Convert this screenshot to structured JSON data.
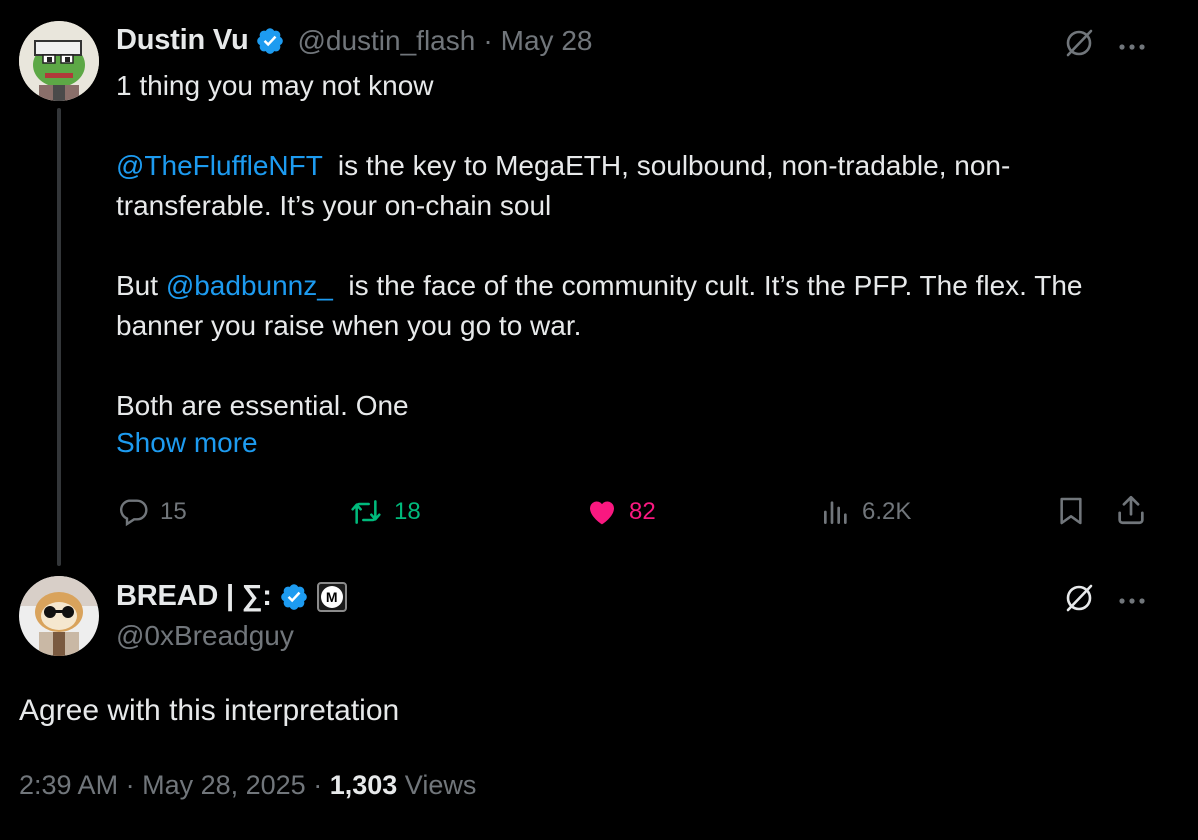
{
  "tweet": {
    "author_name": "Dustin Vu",
    "handle": "@dustin_flash",
    "date": "May 28",
    "line1": "1 thing you may not know",
    "para2_mention": "@TheFluffleNFT",
    "para2_rest": "  is the key to MegaETH, soulbound, non-tradable, non-transferable. It’s your on-chain soul",
    "para3_start": "But ",
    "para3_mention": "@badbunnz_",
    "para3_rest": "  is the face of the community cult. It’s the PFP. The flex. The banner you raise when you go to war.",
    "para4": "Both are essential. One",
    "show_more": "Show more",
    "replies": "15",
    "reposts": "18",
    "likes": "82",
    "views": "6.2K",
    "colors": {
      "repost": "#00ba7c",
      "like": "#f91880",
      "link": "#1d9bf0",
      "verified": "#1d9bf0"
    }
  },
  "reply": {
    "author_name": "BREAD | ∑:",
    "handle": "@0xBreadguy",
    "text": "Agree with this interpretation",
    "time": "2:39 AM",
    "date": "May 28, 2025",
    "views_count": "1,303",
    "views_label": "Views",
    "badge_letter": "M"
  },
  "icons": [
    "grok-icon",
    "more-icon",
    "reply-icon",
    "repost-icon",
    "like-icon",
    "views-icon",
    "bookmark-icon",
    "share-icon",
    "verified-badge-icon"
  ]
}
